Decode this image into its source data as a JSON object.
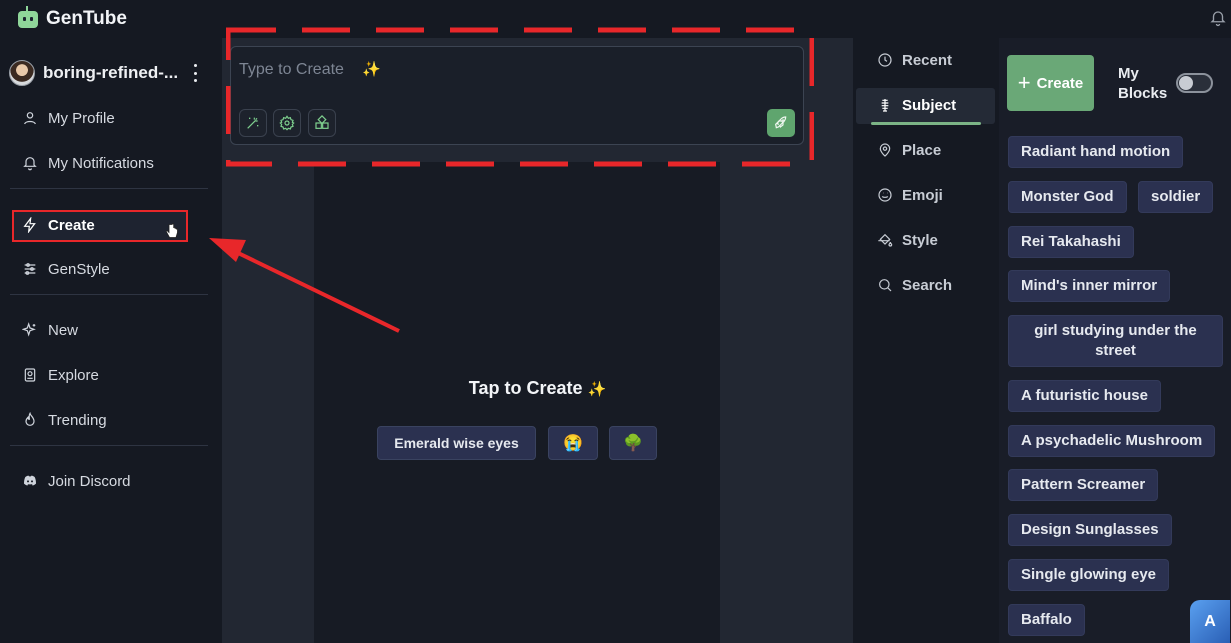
{
  "app": {
    "name": "GenTube"
  },
  "user": {
    "name": "boring-refined-..."
  },
  "sidebar": {
    "items": [
      {
        "label": "My Profile",
        "icon": "user-icon"
      },
      {
        "label": "My Notifications",
        "icon": "bell-icon"
      },
      {
        "label": "Create",
        "icon": "lightning-icon"
      },
      {
        "label": "GenStyle",
        "icon": "sliders-icon"
      },
      {
        "label": "New",
        "icon": "sparkles-icon"
      },
      {
        "label": "Explore",
        "icon": "explore-icon"
      },
      {
        "label": "Trending",
        "icon": "flame-icon"
      },
      {
        "label": "Join Discord",
        "icon": "discord-icon"
      }
    ]
  },
  "prompt": {
    "placeholder": "Type to Create",
    "sparkle": "✨"
  },
  "canvas": {
    "title": "Tap to Create",
    "sparkle": "✨",
    "suggestions": [
      "Emerald wise eyes",
      "😭",
      "🌳"
    ]
  },
  "categories": {
    "items": [
      "Recent",
      "Subject",
      "Place",
      "Emoji",
      "Style",
      "Search"
    ],
    "active": "Subject"
  },
  "blocks": {
    "create_label": "Create",
    "my_blocks_label": "My Blocks",
    "my_blocks_enabled": false,
    "items": [
      "Radiant hand motion",
      "Monster God",
      "soldier",
      "Rei Takahashi",
      "Mind's inner mirror",
      "girl studying under the street",
      "A futuristic house",
      "A psychadelic Mushroom",
      "Pattern Screamer",
      "Design Sunglasses",
      "Single glowing eye",
      "Baffalo"
    ]
  },
  "colors": {
    "accent": "#6aa877",
    "annotation": "#e8272a",
    "chip": "#2b3150"
  }
}
